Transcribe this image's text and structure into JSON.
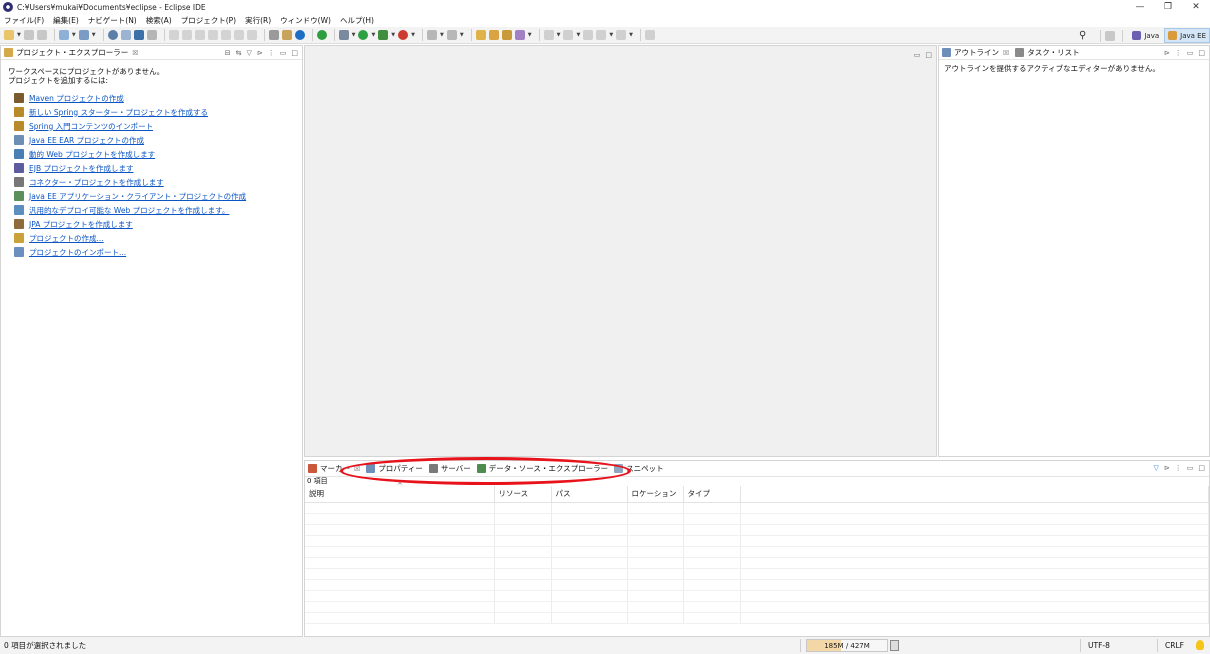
{
  "window": {
    "title": "C:¥Users¥mukai¥Documents¥eclipse - Eclipse IDE",
    "controls": [
      "—",
      "❐",
      "✕"
    ]
  },
  "menu": [
    "ファイル(F)",
    "編集(E)",
    "ナビゲート(N)",
    "検索(A)",
    "プロジェクト(P)",
    "実行(R)",
    "ウィンドウ(W)",
    "ヘルプ(H)"
  ],
  "perspectives": {
    "java": "Java",
    "javaee": "Java EE"
  },
  "project_explorer": {
    "tab_label": "プロジェクト・エクスプローラー",
    "close": "☒",
    "message_line1": "ワークスペースにプロジェクトがありません。",
    "message_line2": "プロジェクトを追加するには:",
    "links": [
      {
        "label": "Maven プロジェクトの作成",
        "icon": "maven-icon",
        "color": "#7a5a2e"
      },
      {
        "label": "新しい Spring スターター・プロジェクトを作成する",
        "icon": "spring-starter-icon",
        "color": "#b88a2a"
      },
      {
        "label": "Spring 入門コンテンツのインポート",
        "icon": "spring-import-icon",
        "color": "#b88a2a"
      },
      {
        "label": "Java EE EAR プロジェクトの作成",
        "icon": "ear-project-icon",
        "color": "#6d8fb4"
      },
      {
        "label": "動的 Web プロジェクトを作成します",
        "icon": "web-project-icon",
        "color": "#4a7fb5"
      },
      {
        "label": "EJB プロジェクトを作成します",
        "icon": "ejb-project-icon",
        "color": "#5c5c9e"
      },
      {
        "label": "コネクター・プロジェクトを作成します",
        "icon": "connector-project-icon",
        "color": "#777777"
      },
      {
        "label": "Java EE アプリケーション・クライアント・プロジェクトの作成",
        "icon": "appclient-project-icon",
        "color": "#5b8f5b"
      },
      {
        "label": "汎用的なデプロイ可能な Web プロジェクトを作成します。",
        "icon": "static-web-icon",
        "color": "#5a8fc0"
      },
      {
        "label": "JPA プロジェクトを作成します",
        "icon": "jpa-project-icon",
        "color": "#8f6a3a"
      },
      {
        "label": "プロジェクトの作成...",
        "icon": "new-project-icon",
        "color": "#c9a23a"
      },
      {
        "label": "プロジェクトのインポート...",
        "icon": "import-project-icon",
        "color": "#6b8fbf"
      }
    ]
  },
  "outline": {
    "tab_outline": "アウトライン",
    "tab_tasks": "タスク・リスト",
    "close": "☒",
    "message": "アウトラインを提供するアクティブなエディターがありません。"
  },
  "bottom": {
    "tabs": [
      "マーカー",
      "プロパティー",
      "サーバー",
      "データ・ソース・エクスプローラー",
      "スニペット"
    ],
    "close": "☒",
    "item_count": "0 項目",
    "sort_arrow": "^",
    "columns": [
      "説明",
      "リソース",
      "パス",
      "ロケーション",
      "タイプ"
    ]
  },
  "status": {
    "selection": "0 項目が選択されました",
    "heap": "185M / 427M",
    "heap_fraction": 0.43,
    "encoding": "UTF-8",
    "line_endings": "CRLF"
  }
}
